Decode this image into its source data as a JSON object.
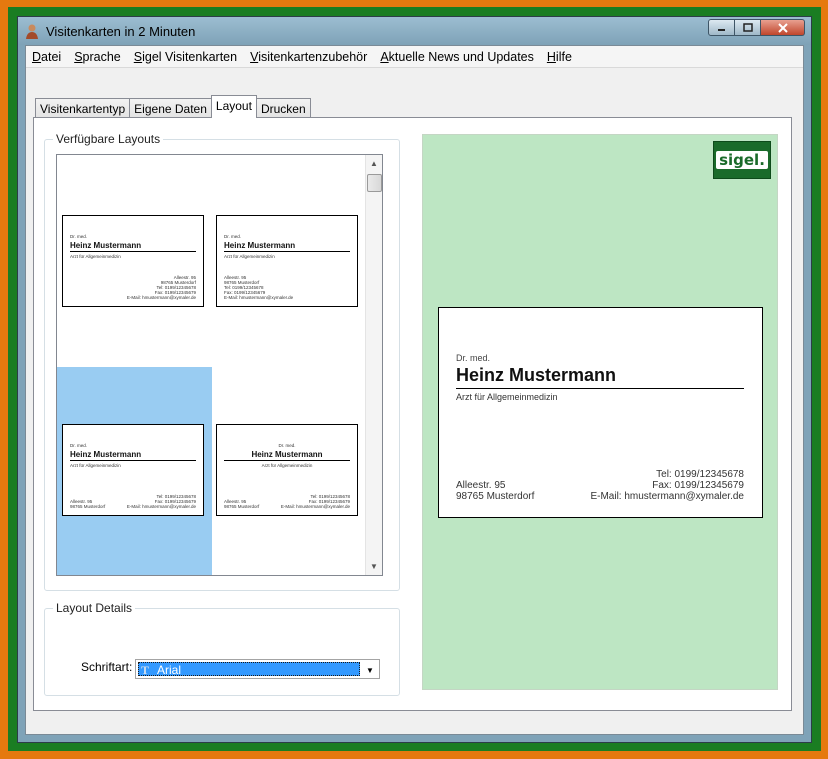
{
  "window": {
    "title": "Visitenkarten in 2 Minuten"
  },
  "menu": [
    {
      "u": "D",
      "rest": "atei"
    },
    {
      "u": "S",
      "rest": "prache"
    },
    {
      "u": "S",
      "rest": "igel Visitenkarten"
    },
    {
      "u": "V",
      "rest": "isitenkartenzubehör"
    },
    {
      "u": "A",
      "rest": "ktuelle News und Updates"
    },
    {
      "u": "H",
      "rest": "ilfe"
    }
  ],
  "tabs": [
    "Visitenkartentyp",
    "Eigene Daten",
    "Layout",
    "Drucken"
  ],
  "active_tab": "Layout",
  "layouts_group": {
    "label": "Verfügbare Layouts"
  },
  "details_group": {
    "label": "Layout Details"
  },
  "font": {
    "label": "Schriftart:",
    "value": "Arial"
  },
  "logo": {
    "text": "sigel."
  },
  "card": {
    "title": "Dr. med.",
    "name": "Heinz Mustermann",
    "specialty": "Arzt für Allgemeinmedizin",
    "street": "Alleestr. 95",
    "city": "98765 Musterdorf",
    "tel": "Tel: 0199/12345678",
    "fax": "Fax: 0199/12345679",
    "email": "E-Mail: hmustermann@xymaler.de"
  },
  "colors": {
    "preview_bg": "#bde6c3",
    "selection": "#99ccf2",
    "outer_frame": "#e5790f",
    "inner_frame": "#1a7d22"
  }
}
